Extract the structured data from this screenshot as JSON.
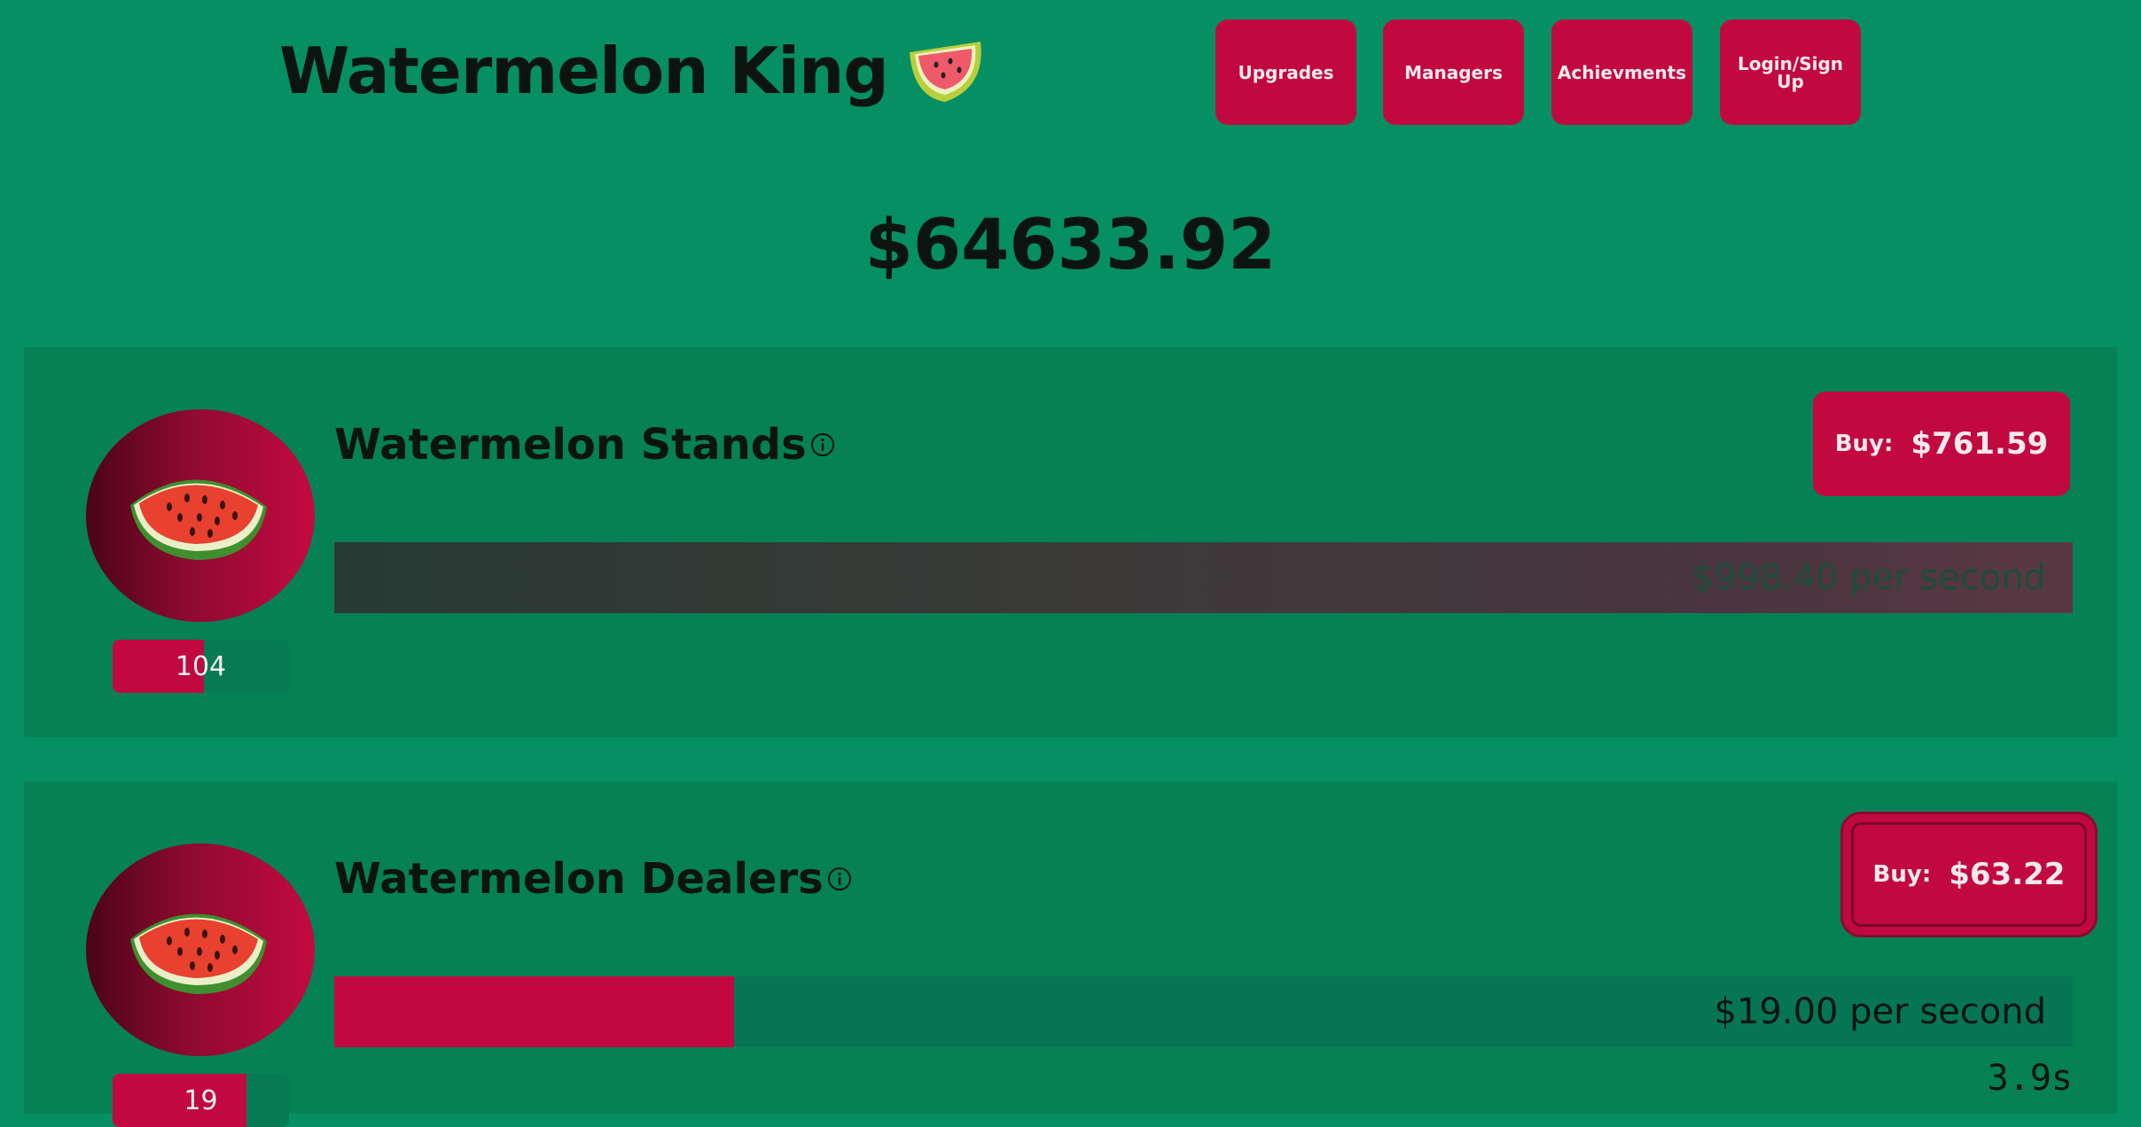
{
  "app": {
    "title": "Watermelon King",
    "title_icon": "watermelon-icon"
  },
  "nav": [
    {
      "label": "Upgrades"
    },
    {
      "label": "Managers"
    },
    {
      "label": "Achievments"
    },
    {
      "label": "Login/Sign Up"
    }
  ],
  "balance": "$64633.92",
  "businesses": [
    {
      "name": "Watermelon Stands",
      "owned": "104",
      "owned_fill_fraction": 0.52,
      "buy_label": "Buy:",
      "buy_price": "$761.59",
      "income": "$998.40 per second",
      "progress_fraction": 1.0,
      "timer": ""
    },
    {
      "name": "Watermelon Dealers",
      "owned": "19",
      "owned_fill_fraction": 0.76,
      "buy_label": "Buy:",
      "buy_price": "$63.22",
      "income": "$19.00 per second",
      "progress_fraction": 0.23,
      "timer": "3.9s"
    }
  ],
  "colors": {
    "background": "#058f63",
    "card": "#068055",
    "accent": "#c2093f",
    "text": "#0c140f"
  }
}
